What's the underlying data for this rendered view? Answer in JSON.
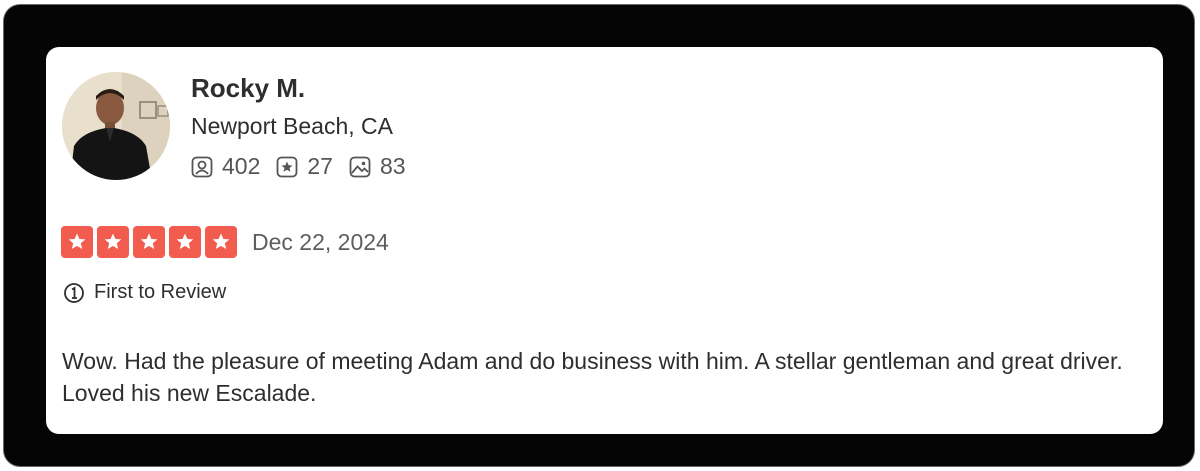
{
  "reviewer": {
    "name": "Rocky M.",
    "location": "Newport Beach, CA",
    "stats": {
      "friends": {
        "icon": "friends-icon",
        "count": "402"
      },
      "reviews": {
        "icon": "reviews-star-icon",
        "count": "27"
      },
      "photos": {
        "icon": "photos-icon",
        "count": "83"
      }
    }
  },
  "review": {
    "rating": 5,
    "rating_max": 5,
    "star_color": "#f15c4f",
    "date": "Dec 22, 2024",
    "badge": {
      "icon": "first-badge-icon",
      "label": "First to Review"
    },
    "text": "Wow. Had the pleasure of meeting Adam and do business with him. A stellar gentleman and great driver. Loved his new Escalade."
  }
}
